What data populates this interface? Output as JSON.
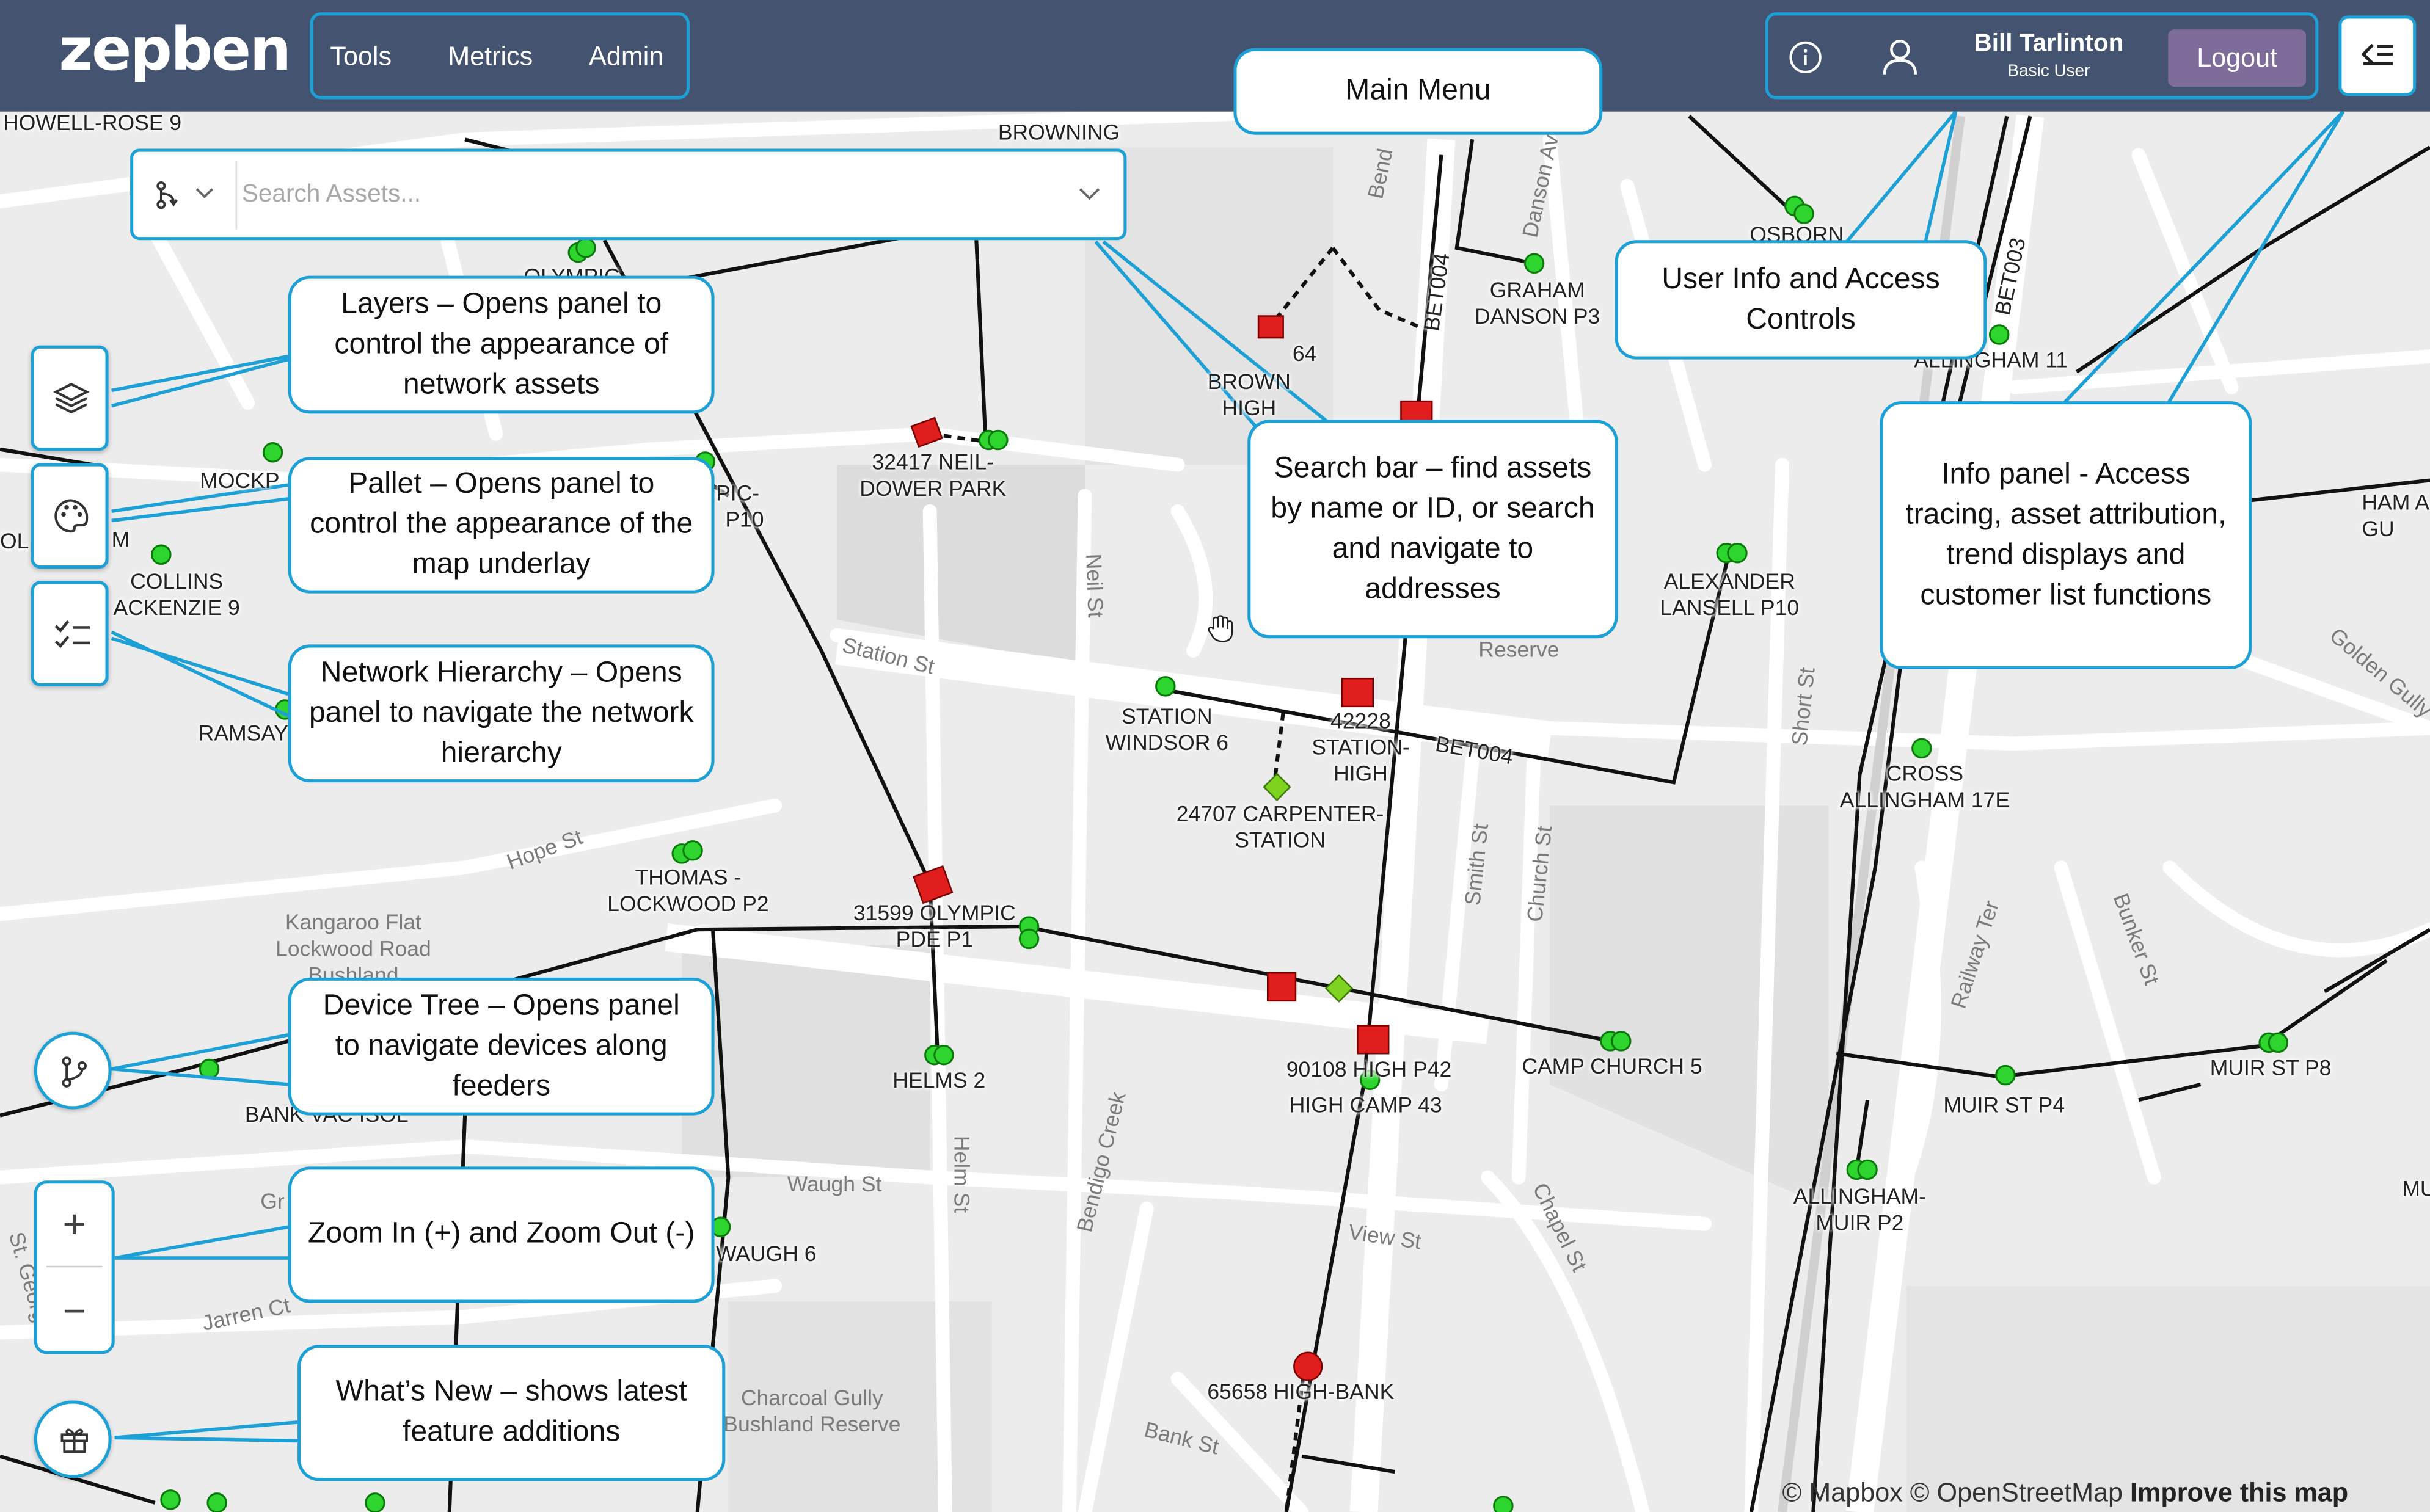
{
  "header": {
    "logo": "zepben",
    "menu": [
      "Tools",
      "Metrics",
      "Admin"
    ],
    "user_name": "Bill Tarlinton",
    "user_role": "Basic User",
    "logout_label": "Logout"
  },
  "search": {
    "placeholder": "Search Assets..."
  },
  "callouts": {
    "main_menu": "Main Menu",
    "user_info": "User Info and Access Controls",
    "layers": "Layers – Opens panel to control the appearance of network assets",
    "pallet": "Pallet – Opens panel to control the appearance of the map underlay",
    "network_hierarchy": "Network Hierarchy – Opens panel to navigate the network hierarchy",
    "search_bar": "Search bar – find assets by name or ID, or search and navigate to addresses",
    "info_panel": "Info panel - Access tracing, asset attribution, trend displays and customer list functions",
    "device_tree": "Device Tree – Opens panel to navigate devices along feeders",
    "zoom": "Zoom In (+) and Zoom Out (-)",
    "whats_new": "What’s New – shows latest feature additions"
  },
  "zoom": {
    "in": "+",
    "out": "−"
  },
  "map_labels": {
    "howell_rose": "HOWELL-ROSE 9",
    "browning": "BROWNING",
    "olympic": "OLYMPIC",
    "osborn": "OSBORN",
    "bet003": "BET003",
    "bet004_v": "BET004",
    "bet004_h": "BET004",
    "graham": "GRAHAM DANSON P3",
    "brown_high": "BROWN HIGH",
    "brown_64": "64",
    "allingham11": "ALLINGHAM 11",
    "ham": "HAM A GU",
    "mockp": "MOCKP",
    "pic": "PIC-",
    "p10": "P10",
    "neil_dower": "32417 NEIL-DOWER PARK",
    "collins": "COLLINS ACKENZIE 9",
    "m": "M",
    "ol": "OL",
    "alexander": "ALEXANDER LANSELL P10",
    "ramsay": "RAMSAY",
    "station_windsor": "STATION WINDSOR 6",
    "station_high": "42228 STATION-HIGH",
    "carpenter": "24707 CARPENTER-STATION",
    "cross_allingham": "CROSS ALLINGHAM 17E",
    "thomas": "THOMAS - LOCKWOOD P2",
    "olympic_pde": "31599 OLYMPIC PDE P1",
    "helms": "HELMS 2",
    "high_p42": "90108 HIGH P42",
    "high_camp": "HIGH CAMP 43",
    "camp_church": "CAMP CHURCH 5",
    "muir_p4": "MUIR ST P4",
    "muir_p8": "MUIR ST P8",
    "allingham_muir": "ALLINGHAM-MUIR P2",
    "mu": "MU",
    "bank": "BANK VAC ISOL",
    "waugh": "WAUGH 6",
    "high_bank": "65658 HIGH-BANK"
  },
  "streets": {
    "station_st": "Station St",
    "neil_st": "Neil St",
    "hope_st": "Hope St",
    "smith_st": "Smith St",
    "church_st": "Church St",
    "short_st": "Short St",
    "reserve": "Reserve",
    "golden_gully": "Golden Gully",
    "railway_ter": "Railway Ter",
    "bunker_st": "Bunker St",
    "kangaroo": "Kangaroo Flat Lockwood Road Bushland Reserve",
    "bendigo_creek": "Bendigo Creek",
    "helm_st": "Helm St",
    "waugh_st": "Waugh St",
    "view_st": "View St",
    "chapel_st": "Chapel St",
    "jarren_ct": "Jarren Ct",
    "st_george": "St. George",
    "charcoal": "Charcoal Gully Bushland Reserve",
    "bank_st": "Bank St",
    "danson_av": "Danson Av",
    "bend": "Bend",
    "gr": "Gr"
  },
  "attribution": {
    "mapbox": "© Mapbox",
    "osm": "© OpenStreetMap",
    "improve": "Improve this map"
  },
  "colors": {
    "header": "#44536f",
    "accent": "#1ca0d6",
    "logout": "#7e6d9a",
    "node": "#2fd52f",
    "asset": "#e01e1e"
  }
}
